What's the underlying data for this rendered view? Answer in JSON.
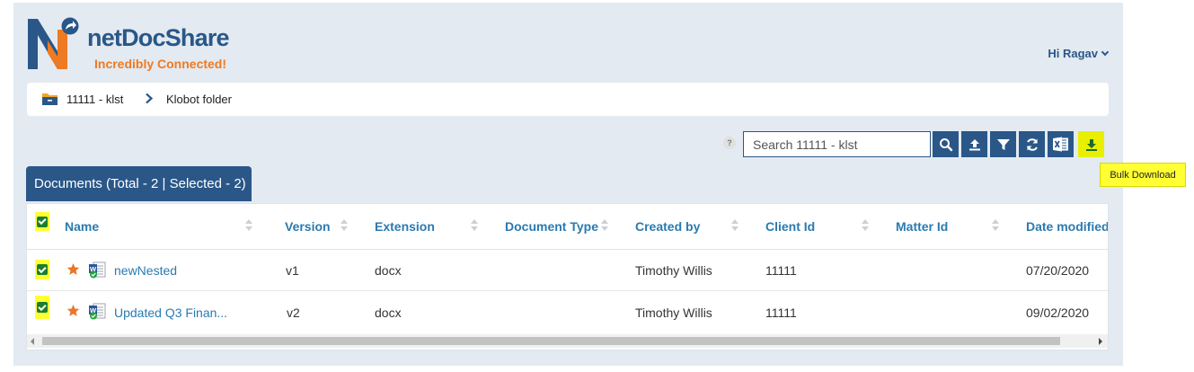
{
  "brand": {
    "name": "netDocShare",
    "tagline": "Incredibly Connected!",
    "color_primary": "#2a5788",
    "color_accent": "#ee7a22"
  },
  "user": {
    "greeting": "Hi Ragav",
    "icon": "chevron-down-icon"
  },
  "breadcrumb": {
    "items": [
      "11111 - klst",
      "Klobot folder"
    ],
    "icons": [
      "folder-icon",
      "chevron-right-icon"
    ]
  },
  "toolbar": {
    "help": "?",
    "search_placeholder": "Search 11111 - klst",
    "buttons": [
      "search-icon",
      "upload-icon",
      "filter-icon",
      "refresh-icon",
      "excel-export-icon",
      "bulk-download-icon"
    ],
    "tooltip": "Bulk Download",
    "highlight_color": "#ffff33"
  },
  "documents": {
    "tab_label": "Documents (Total - 2 | Selected - 2)",
    "columns": [
      "Name",
      "Version",
      "Extension",
      "Document Type",
      "Created by",
      "Client Id",
      "Matter Id",
      "Date modified"
    ],
    "rows": [
      {
        "selected": true,
        "starred": true,
        "name": "newNested",
        "version": "v1",
        "extension": "docx",
        "doc_type": "",
        "created_by": "Timothy Willis",
        "client_id": "11111",
        "matter_id": "",
        "date_modified": "07/20/2020"
      },
      {
        "selected": true,
        "starred": true,
        "name": "Updated Q3 Finan...",
        "version": "v2",
        "extension": "docx",
        "doc_type": "",
        "created_by": "Timothy Willis",
        "client_id": "11111",
        "matter_id": "",
        "date_modified": "09/02/2020"
      }
    ]
  }
}
